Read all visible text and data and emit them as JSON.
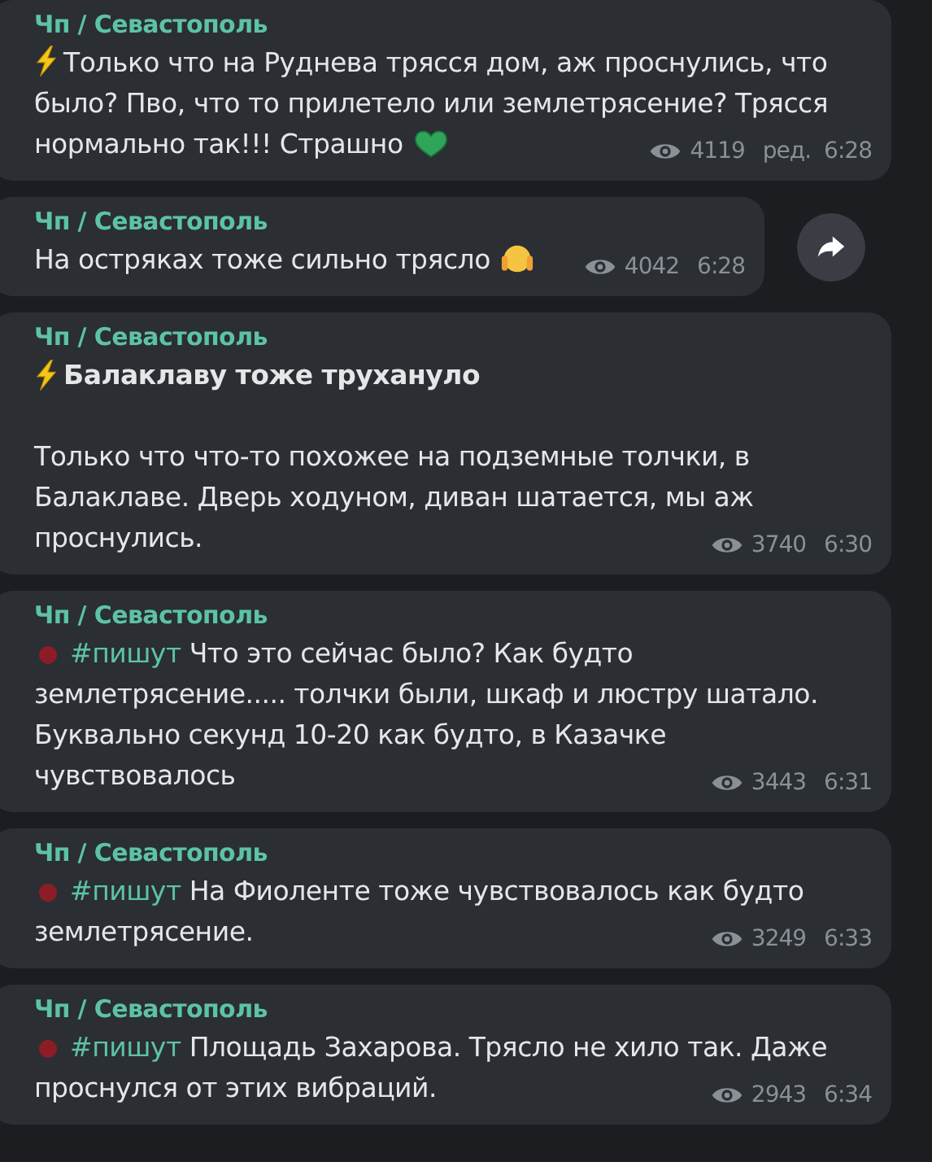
{
  "messages": [
    {
      "author": "Чп / Севастополь",
      "lead": {
        "kind": "lightning"
      },
      "text": "Только что на Руднева трясся дом, аж проснулись, что было? Пво, что то прилетело или землетрясение? Трясся нормально так!!! Страшно",
      "emoji": {
        "kind": "heart"
      },
      "views": "4119",
      "edited": "ред.",
      "time": "6:28"
    },
    {
      "author": "Чп / Севастополь",
      "text": "На остряках тоже сильно трясло",
      "emoji": {
        "kind": "scream"
      },
      "views": "4042",
      "time": "6:28",
      "share_button": true
    },
    {
      "author": "Чп / Севастополь",
      "lead": {
        "kind": "lightning"
      },
      "title": "Балаклаву тоже трухануло",
      "text": "Только что что-то похожее на подземные толчки, в Балаклаве. Дверь ходуном, диван шатается, мы аж проснулись.",
      "views": "3740",
      "time": "6:30"
    },
    {
      "author": "Чп / Севастополь",
      "lead": {
        "kind": "dot"
      },
      "hashtag": "#пишут",
      "text": "Что это сейчас было? Как будто землетрясение..... толчки были, шкаф и люстру шатало. Буквально секунд 10-20 как будто, в Казачке чувствовалось",
      "views": "3443",
      "time": "6:31"
    },
    {
      "author": "Чп / Севастополь",
      "lead": {
        "kind": "dot"
      },
      "hashtag": "#пишут",
      "text": "На Фиоленте тоже чувствовалось как будто землетрясение.",
      "views": "3249",
      "time": "6:33"
    },
    {
      "author": "Чп / Севастополь",
      "lead": {
        "kind": "dot"
      },
      "hashtag": "#пишут",
      "text": "Площадь Захарова. Трясло не хило так. Даже проснулся от этих вибраций.",
      "views": "2943",
      "time": "6:34"
    }
  ]
}
